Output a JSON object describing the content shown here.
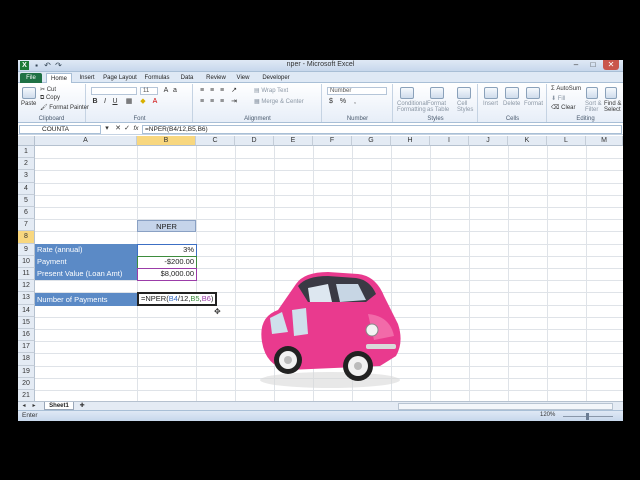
{
  "window": {
    "title": "nper - Microsoft Excel",
    "qat": [
      "save-icon",
      "undo-icon",
      "redo-icon"
    ],
    "controls": [
      "minimize",
      "maximize",
      "close"
    ]
  },
  "ribbon_tabs": [
    "File",
    "Home",
    "Insert",
    "Page Layout",
    "Formulas",
    "Data",
    "Review",
    "View",
    "Developer"
  ],
  "ribbon": {
    "clipboard": {
      "label": "Clipboard",
      "paste": "Paste",
      "cut": "Cut",
      "copy": "Copy",
      "format_painter": "Format Painter"
    },
    "font": {
      "label": "Font",
      "size": "11"
    },
    "alignment": {
      "label": "Alignment",
      "wrap_text": "Wrap Text",
      "merge_center": "Merge & Center"
    },
    "number": {
      "label": "Number",
      "format": "Number",
      "currency": "$",
      "percent": "%"
    },
    "styles": {
      "label": "Styles",
      "conditional": "Conditional Formatting",
      "format_table": "Format as Table",
      "cell_styles": "Cell Styles"
    },
    "cells": {
      "label": "Cells",
      "insert": "Insert",
      "delete": "Delete",
      "format": "Format"
    },
    "editing": {
      "label": "Editing",
      "autosum": "AutoSum",
      "fill": "Fill",
      "clear": "Clear",
      "sort_filter": "Sort & Filter",
      "find_select": "Find & Select"
    }
  },
  "formula_bar": {
    "name_box": "COUNTA",
    "cancel": "✕",
    "enter": "✓",
    "fx": "fx",
    "formula": "=NPER(B4/12,B5,B6)"
  },
  "columns": [
    "A",
    "B",
    "C",
    "D",
    "E",
    "F",
    "G",
    "H",
    "I",
    "J",
    "K",
    "L",
    "M"
  ],
  "rows": [
    "1",
    "2",
    "3",
    "4",
    "5",
    "6",
    "7",
    "8",
    "9",
    "10",
    "11",
    "12",
    "13",
    "14",
    "15",
    "16",
    "17",
    "18",
    "19",
    "20",
    "21"
  ],
  "cells": {
    "b2": "NPER",
    "a4": "Rate (annual)",
    "b4": "3%",
    "a5": "Payment",
    "b5": "-$200.00",
    "a6": "Present Value (Loan Amt)",
    "b6": "$8,000.00",
    "a8": "Number of Payments",
    "b8_prefix": "=NPER(",
    "b8_ref1": "B4",
    "b8_mid1": "/12,",
    "b8_ref2": "B5",
    "b8_sep": ",",
    "b8_ref3": "B6",
    "b8_suffix": ")"
  },
  "colors": {
    "ref_b4": "#3c6fc4",
    "ref_b5": "#3d8c3d",
    "ref_b6": "#9b3ca8",
    "car": "#e93a8e"
  },
  "sheet_tabs": [
    "Sheet1"
  ],
  "status": {
    "mode": "Enter",
    "zoom": "120%"
  }
}
